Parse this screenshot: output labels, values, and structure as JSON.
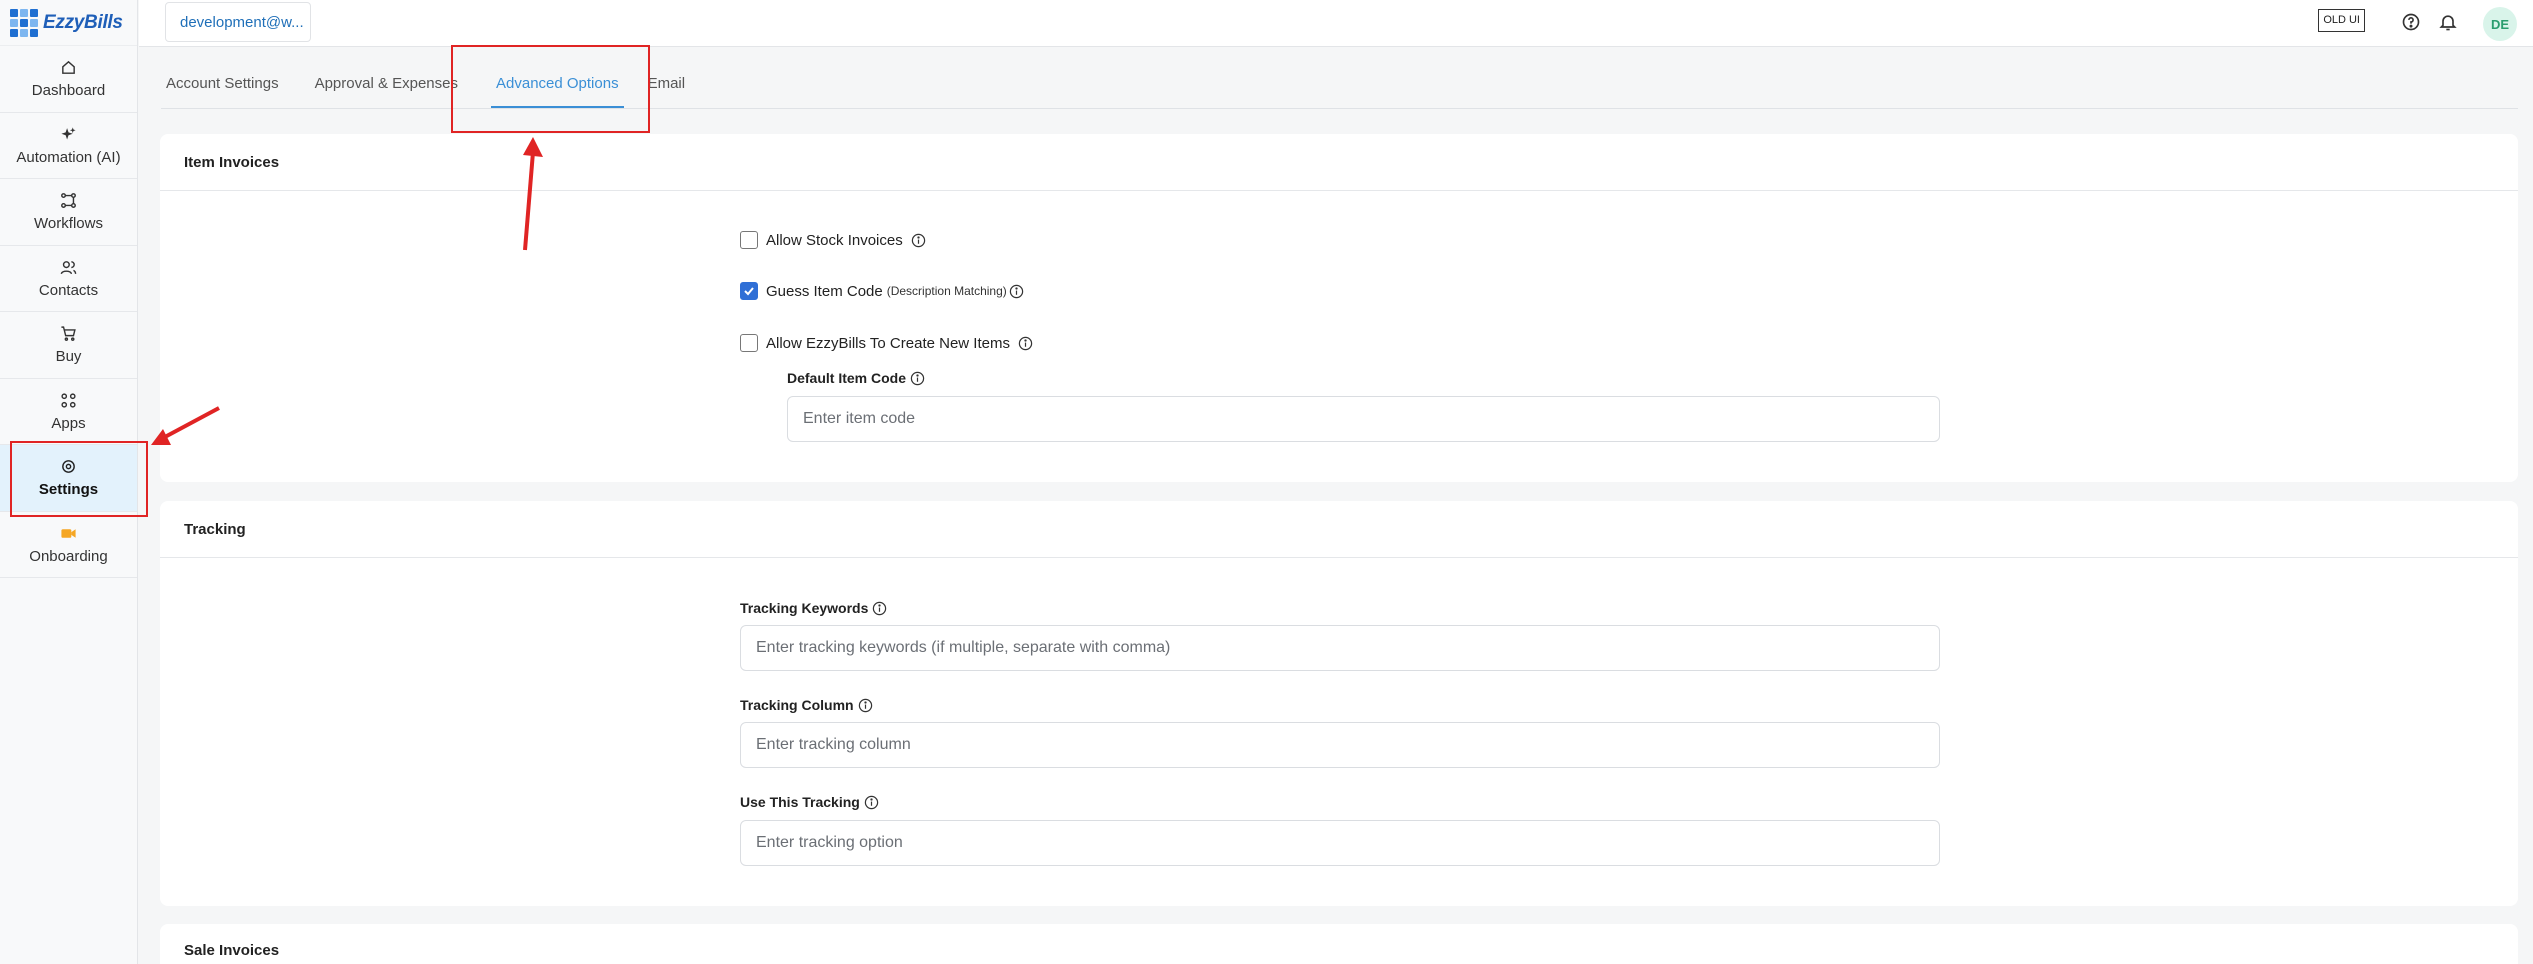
{
  "app": {
    "logo_text": "EzzyBills"
  },
  "sidebar": {
    "items": [
      {
        "label": "Dashboard",
        "icon": "home-icon"
      },
      {
        "label": "Automation (AI)",
        "icon": "sparkle-icon"
      },
      {
        "label": "Workflows",
        "icon": "workflow-icon"
      },
      {
        "label": "Contacts",
        "icon": "contacts-icon"
      },
      {
        "label": "Buy",
        "icon": "cart-icon"
      },
      {
        "label": "Apps",
        "icon": "apps-grid-icon"
      },
      {
        "label": "Settings",
        "icon": "gear-icon",
        "active": true
      },
      {
        "label": "Onboarding",
        "icon": "video-camera-icon"
      }
    ]
  },
  "topbar": {
    "org": "development@w...",
    "old_ui": "OLD UI",
    "avatar": "DE"
  },
  "tabs": [
    {
      "label": "Account Settings"
    },
    {
      "label": "Approval & Expenses"
    },
    {
      "label": "Advanced Options",
      "active": true
    },
    {
      "label": "Email"
    }
  ],
  "item_invoices": {
    "title": "Item Invoices",
    "allow_stock": {
      "label": "Allow Stock Invoices",
      "checked": false
    },
    "guess_item": {
      "label": "Guess Item Code",
      "sub": "(Description Matching)",
      "checked": true
    },
    "allow_create": {
      "label": "Allow EzzyBills To Create New Items",
      "checked": false
    },
    "default_code": {
      "label": "Default Item Code",
      "placeholder": "Enter item code"
    }
  },
  "tracking": {
    "title": "Tracking",
    "keywords": {
      "label": "Tracking Keywords",
      "placeholder": "Enter tracking keywords (if multiple, separate with comma)"
    },
    "column": {
      "label": "Tracking Column",
      "placeholder": "Enter tracking column"
    },
    "use": {
      "label": "Use This Tracking",
      "placeholder": "Enter tracking option"
    }
  },
  "sale_invoices": {
    "title": "Sale Invoices"
  },
  "colors": {
    "accent": "#3a8fd6",
    "annotation": "#e02424",
    "checkbox": "#2f6fd6"
  }
}
